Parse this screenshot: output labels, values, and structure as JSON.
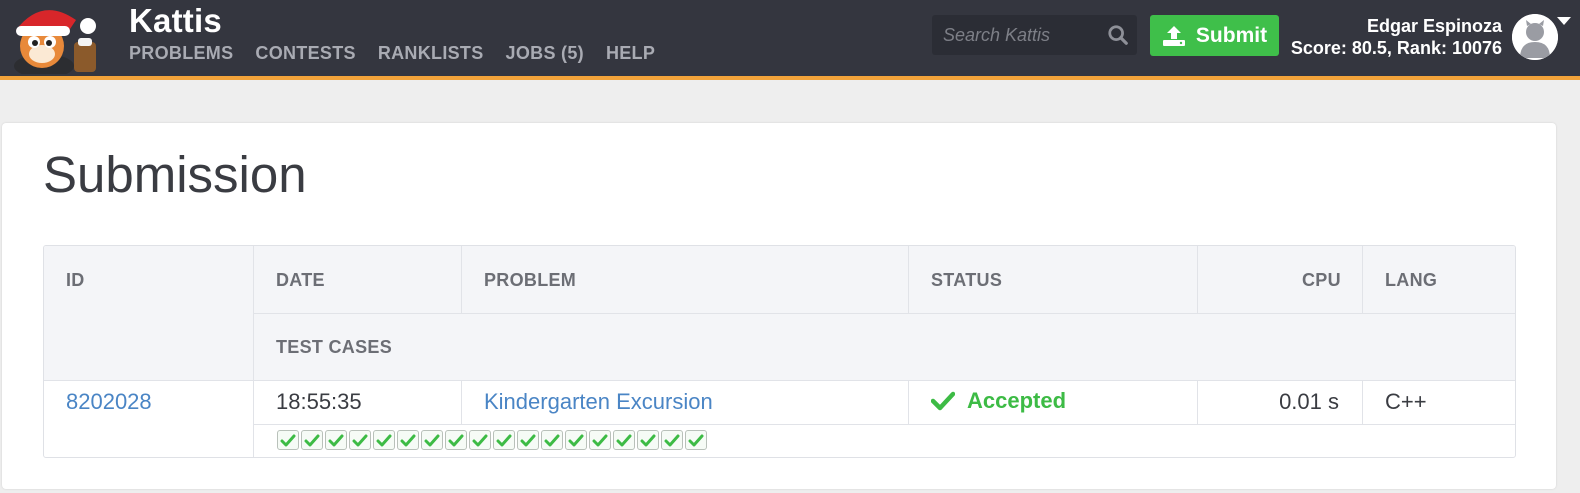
{
  "nav": {
    "brand": "Kattis",
    "links": [
      "PROBLEMS",
      "CONTESTS",
      "RANKLISTS",
      "JOBS (5)",
      "HELP"
    ],
    "search_placeholder": "Search Kattis",
    "submit_label": "Submit",
    "user_name": "Edgar Espinoza",
    "user_stats": "Score: 80.5, Rank: 10076"
  },
  "page": {
    "title": "Submission"
  },
  "table": {
    "headers": {
      "id": "ID",
      "date": "DATE",
      "problem": "PROBLEM",
      "status": "STATUS",
      "cpu": "CPU",
      "lang": "LANG",
      "test_cases": "TEST CASES"
    },
    "row": {
      "id": "8202028",
      "date": "18:55:35",
      "problem": "Kindergarten Excursion",
      "status": "Accepted",
      "cpu": "0.01 s",
      "lang": "C++",
      "test_cases_total": 18,
      "test_cases_passed": 18
    }
  },
  "colors": {
    "navbar": "#34363f",
    "navbar_accent": "#f2a33a",
    "submit": "#3fbf4a",
    "link": "#4a85c5",
    "accepted": "#3dbb45"
  },
  "icons": [
    "santa-cat-logo-icon",
    "search-icon",
    "upload-icon",
    "avatar-icon",
    "chevron-down-icon",
    "checkmark-icon"
  ]
}
